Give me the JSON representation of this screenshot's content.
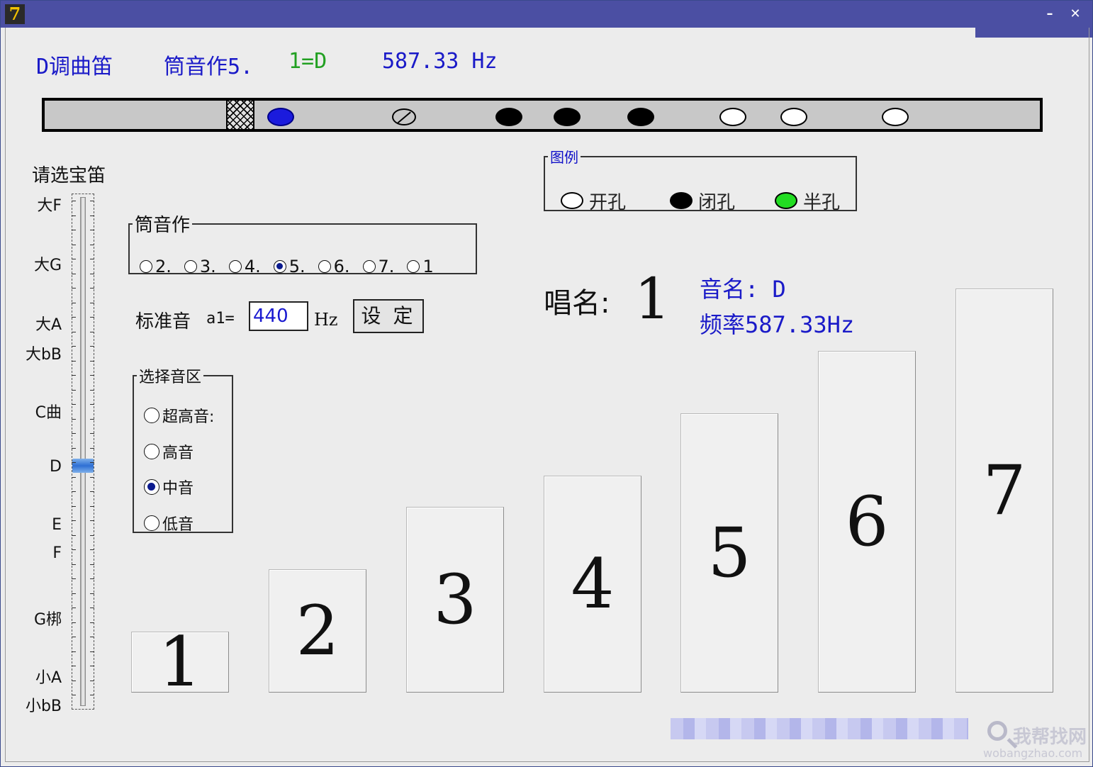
{
  "colors": {
    "titlebar": "#4b4fa3",
    "accent_blue": "#1a1ac8",
    "green": "#22a022",
    "membrane": "#1b1bdd",
    "half_hole": "#22dd22"
  },
  "titlebar": {
    "app_icon": "7",
    "minimize": "–",
    "close": "✕"
  },
  "header": {
    "flute_key": "D调曲笛",
    "fingering": "筒音作5.",
    "tonic": "1=D",
    "frequency": "587.33 Hz"
  },
  "flute": {
    "icons": [
      "embouchure-hole-icon",
      "membrane-hole-icon",
      "back-thumb-hole-icon"
    ],
    "holes": [
      {
        "name": "hole-1-closed",
        "state": "closed"
      },
      {
        "name": "hole-2-closed",
        "state": "closed"
      },
      {
        "name": "hole-3-closed",
        "state": "closed"
      },
      {
        "name": "hole-4-open",
        "state": "open"
      },
      {
        "name": "hole-5-open",
        "state": "open"
      },
      {
        "name": "hole-6-open",
        "state": "open"
      }
    ]
  },
  "legend": {
    "title": "图例",
    "open": "开孔",
    "closed": "闭孔",
    "half": "半孔"
  },
  "slider": {
    "title": "请选宝笛",
    "labels": [
      "大F",
      "大G",
      "大A",
      "大bB",
      "C曲",
      "D",
      "E",
      "F",
      "G梆",
      "小A",
      "小bB"
    ],
    "selected": "D"
  },
  "tube_note": {
    "title": "筒音作",
    "options": [
      "2.",
      "3.",
      "4.",
      "5.",
      "6.",
      "7.",
      "1"
    ],
    "selected": "5."
  },
  "standard": {
    "label": "标准音",
    "a1": "a1=",
    "value": "440",
    "unit": "Hz",
    "button": "设 定"
  },
  "register": {
    "title": "选择音区",
    "options": [
      "超高音:",
      "高音",
      "中音",
      "低音"
    ],
    "selected": "中音"
  },
  "current": {
    "sing_label": "唱名:",
    "sing_value": "1",
    "note_name": "音名: D",
    "freq": "频率587.33Hz"
  },
  "keys": [
    "1",
    "2",
    "3",
    "4",
    "5",
    "6",
    "7"
  ],
  "watermark": {
    "text": "我帮找网",
    "url": "wobangzhao.com"
  }
}
